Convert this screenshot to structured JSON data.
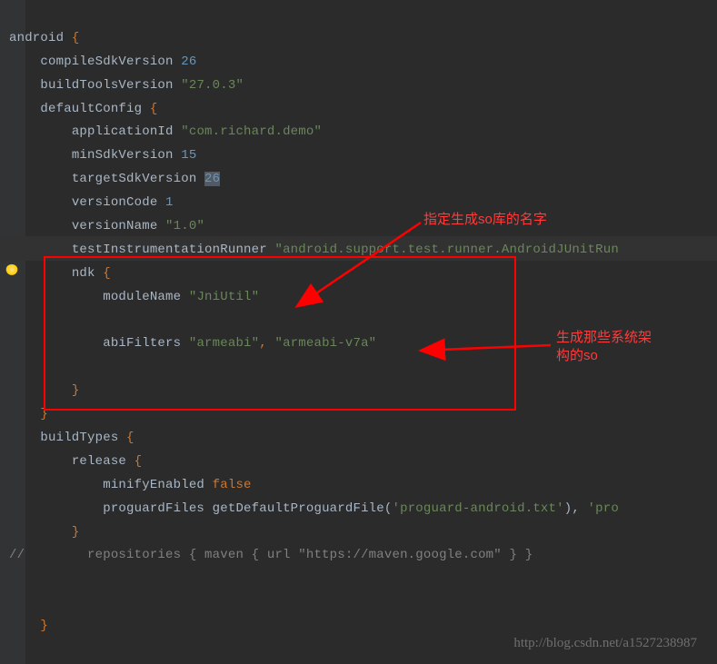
{
  "code": {
    "android_open": "android",
    "brace_open": "{",
    "brace_close": "}",
    "compileSdkVersion_key": "compileSdkVersion",
    "compileSdkVersion_val": "26",
    "buildToolsVersion_key": "buildToolsVersion",
    "buildToolsVersion_val": "\"27.0.3\"",
    "defaultConfig_key": "defaultConfig",
    "applicationId_key": "applicationId",
    "applicationId_val": "\"com.richard.demo\"",
    "minSdkVersion_key": "minSdkVersion",
    "minSdkVersion_val": "15",
    "targetSdkVersion_key": "targetSdkVersion",
    "targetSdkVersion_val": "26",
    "versionCode_key": "versionCode",
    "versionCode_val": "1",
    "versionName_key": "versionName",
    "versionName_val": "\"1.0\"",
    "testInstrumentationRunner_key": "testInstrumentationRunner",
    "testInstrumentationRunner_val": "\"android.support.test.runner.AndroidJUnitRun",
    "ndk_key": "ndk",
    "moduleName_key": "moduleName",
    "moduleName_val": "\"JniUtil\"",
    "abiFilters_key": "abiFilters",
    "abiFilters_val1": "\"armeabi\"",
    "abiFilters_comma": ", ",
    "abiFilters_val2": "\"armeabi-v7a\"",
    "buildTypes_key": "buildTypes",
    "release_key": "release",
    "minifyEnabled_key": "minifyEnabled",
    "minifyEnabled_val": "false",
    "proguardFiles_key": "proguardFiles",
    "getDefaultProguardFile": "getDefaultProguardFile(",
    "proguard_android_txt": "'proguard-android.txt'",
    "paren_close_comma": "), ",
    "proguard_pro": "'pro",
    "comment_slashes": "//",
    "comment_text": "        repositories { maven { url \"https://maven.google.com\" } }"
  },
  "annotations": {
    "a1": "指定生成so库的名字",
    "a2_line1": "生成那些系统架",
    "a2_line2": "构的so"
  },
  "watermark": "http://blog.csdn.net/a1527238987"
}
